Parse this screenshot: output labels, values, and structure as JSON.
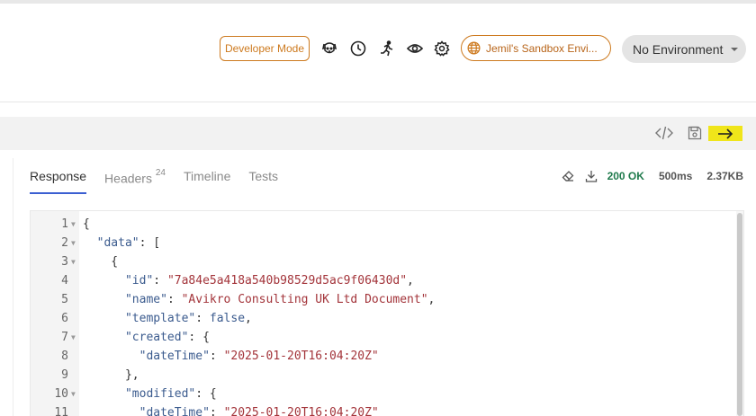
{
  "topbar": {
    "developer_mode": "Developer Mode",
    "workspace": "Jemil's Sandbox Envi...",
    "environment": "No Environment",
    "icons": [
      "dog-icon",
      "clock-icon",
      "runner-icon",
      "eye-icon",
      "gear-icon"
    ]
  },
  "request_bar": {
    "icons": [
      "code-icon",
      "save-icon",
      "send-arrow-icon"
    ],
    "send_color": "#f0e51a"
  },
  "response": {
    "tabs": [
      {
        "label": "Response",
        "active": true
      },
      {
        "label": "Headers",
        "count": "24"
      },
      {
        "label": "Timeline"
      },
      {
        "label": "Tests"
      }
    ],
    "status": "200 OK",
    "time": "500ms",
    "size": "2.37KB"
  },
  "editor": {
    "lines": [
      {
        "n": "1",
        "fold": true
      },
      {
        "n": "2",
        "fold": true
      },
      {
        "n": "3",
        "fold": true
      },
      {
        "n": "4",
        "fold": false,
        "key": "\"id\"",
        "value": "\"7a84e5a418a540b98529d5ac9f06430d\""
      },
      {
        "n": "5",
        "fold": false,
        "key": "\"name\"",
        "value": "\"Avikro Consulting UK Ltd Document\""
      },
      {
        "n": "6",
        "fold": false,
        "key": "\"template\"",
        "value": "false"
      },
      {
        "n": "7",
        "fold": true,
        "key": "\"created\""
      },
      {
        "n": "8",
        "fold": false,
        "key": "\"dateTime\"",
        "value": "\"2025-01-20T16:04:20Z\""
      },
      {
        "n": "9",
        "fold": false
      },
      {
        "n": "10",
        "fold": true,
        "key": "\"modified\""
      },
      {
        "n": "11",
        "fold": false,
        "key": "\"dateTime\"",
        "value": "\"2025-01-20T16:04:20Z\""
      }
    ],
    "data_key": "\"data\""
  }
}
